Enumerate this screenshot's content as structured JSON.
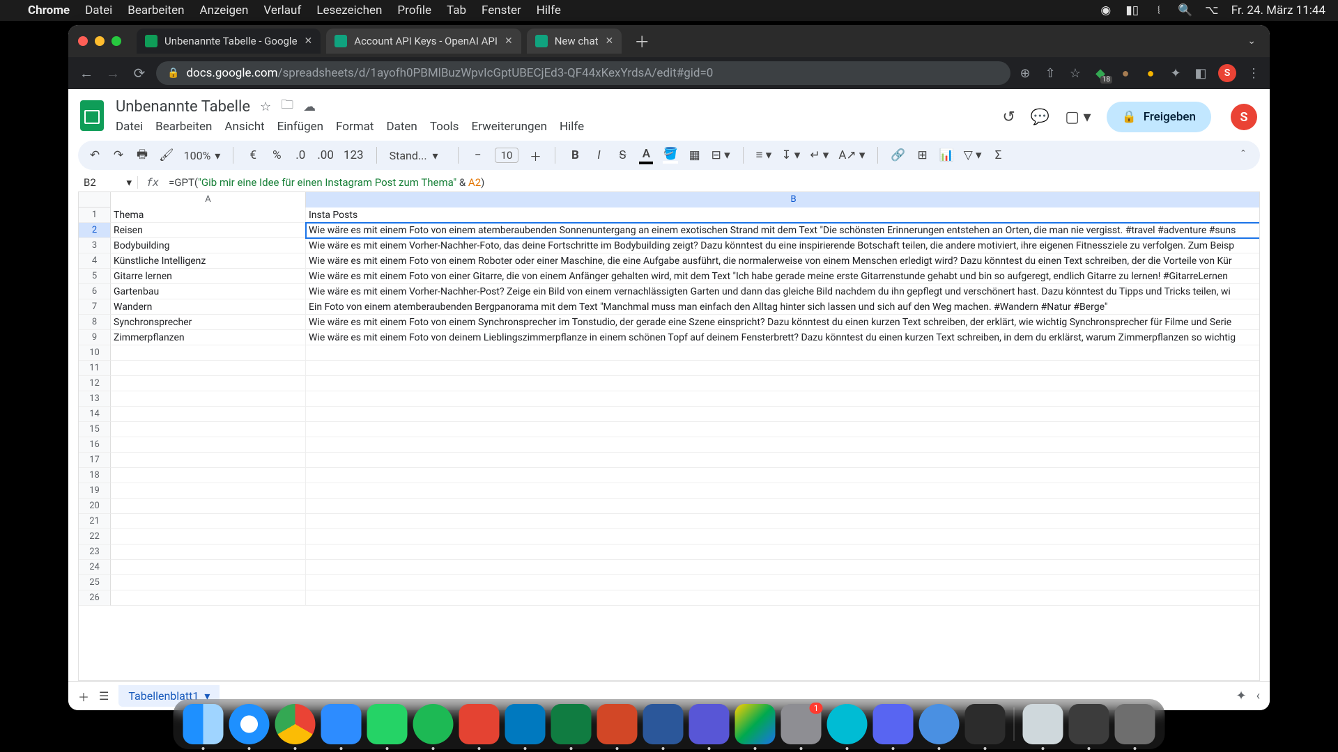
{
  "mac_menu": {
    "app": "Chrome",
    "items": [
      "Datei",
      "Bearbeiten",
      "Anzeigen",
      "Verlauf",
      "Lesezeichen",
      "Profile",
      "Tab",
      "Fenster",
      "Hilfe"
    ],
    "clock": "Fr. 24. März 11:44"
  },
  "browser": {
    "tabs": [
      {
        "title": "Unbenannte Tabelle - Google",
        "active": true
      },
      {
        "title": "Account API Keys - OpenAI API",
        "active": false
      },
      {
        "title": "New chat",
        "active": false
      }
    ],
    "url_domain": "docs.google.com",
    "url_path": "/spreadsheets/d/1ayofh0PBMlBuzWpvIcGptUBECjEd3-QF44xKexYrdsA/edit#gid=0",
    "ext_count": "18",
    "profile_letter": "S"
  },
  "sheets": {
    "doc_title": "Unbenannte Tabelle",
    "menus": [
      "Datei",
      "Bearbeiten",
      "Ansicht",
      "Einfügen",
      "Format",
      "Daten",
      "Tools",
      "Erweiterungen",
      "Hilfe"
    ],
    "share_label": "Freigeben",
    "avatar_letter": "S",
    "zoom": "100%",
    "font_family": "Stand...",
    "font_size": "10",
    "name_box": "B2",
    "formula": {
      "prefix": "=GPT(",
      "string": "\"Gib mir eine Idee für einen Instagram Post zum Thema\"",
      "op": " & ",
      "ref": "A2",
      "suffix": ")"
    },
    "columns": [
      "A",
      "B"
    ],
    "rows": [
      {
        "n": "1",
        "a": "Thema",
        "b": "Insta Posts"
      },
      {
        "n": "2",
        "a": "Reisen",
        "b": "Wie wäre es mit einem Foto von einem atemberaubenden Sonnenuntergang an einem exotischen Strand mit dem Text \"Die schönsten Erinnerungen entstehen an Orten, die man nie vergisst. #travel #adventure #suns"
      },
      {
        "n": "3",
        "a": "Bodybuilding",
        "b": "Wie wäre es mit einem Vorher-Nachher-Foto, das deine Fortschritte im Bodybuilding zeigt? Dazu könntest du eine inspirierende Botschaft teilen, die andere motiviert, ihre eigenen Fitnessziele zu verfolgen. Zum Beisp"
      },
      {
        "n": "4",
        "a": "Künstliche Intelligenz",
        "b": "Wie wäre es mit einem Foto von einem Roboter oder einer Maschine, die eine Aufgabe ausführt, die normalerweise von einem Menschen erledigt wird? Dazu könntest du einen Text schreiben, der die Vorteile von Kür"
      },
      {
        "n": "5",
        "a": "Gitarre lernen",
        "b": "Wie wäre es mit einem Foto von einer Gitarre, die von einem Anfänger gehalten wird, mit dem Text \"Ich habe gerade meine erste Gitarrenstunde gehabt und bin so aufgeregt, endlich Gitarre zu lernen! #GitarreLernen"
      },
      {
        "n": "6",
        "a": "Gartenbau",
        "b": "Wie wäre es mit einem Vorher-Nachher-Post? Zeige ein Bild von einem vernachlässigten Garten und dann das gleiche Bild nachdem du ihn gepflegt und verschönert hast. Dazu könntest du Tipps und Tricks teilen, wi"
      },
      {
        "n": "7",
        "a": "Wandern",
        "b": "Ein Foto von einem atemberaubenden Bergpanorama mit dem Text \"Manchmal muss man einfach den Alltag hinter sich lassen und sich auf den Weg machen. #Wandern #Natur #Berge\""
      },
      {
        "n": "8",
        "a": "Synchronsprecher",
        "b": "Wie wäre es mit einem Foto von einem Synchronsprecher im Tonstudio, der gerade eine Szene einspricht? Dazu könntest du einen kurzen Text schreiben, der erklärt, wie wichtig Synchronsprecher für Filme und Serie"
      },
      {
        "n": "9",
        "a": "Zimmerpflanzen",
        "b": "Wie wäre es mit einem Foto von deinem Lieblingszimmerpflanze in einem schönen Topf auf deinem Fensterbrett? Dazu könntest du einen kurzen Text schreiben, in dem du erklärst, warum Zimmerpflanzen so wichtig"
      },
      {
        "n": "10",
        "a": "",
        "b": ""
      },
      {
        "n": "11",
        "a": "",
        "b": ""
      },
      {
        "n": "12",
        "a": "",
        "b": ""
      },
      {
        "n": "13",
        "a": "",
        "b": ""
      },
      {
        "n": "14",
        "a": "",
        "b": ""
      },
      {
        "n": "15",
        "a": "",
        "b": ""
      },
      {
        "n": "16",
        "a": "",
        "b": ""
      },
      {
        "n": "17",
        "a": "",
        "b": ""
      },
      {
        "n": "18",
        "a": "",
        "b": ""
      },
      {
        "n": "19",
        "a": "",
        "b": ""
      },
      {
        "n": "20",
        "a": "",
        "b": ""
      },
      {
        "n": "21",
        "a": "",
        "b": ""
      },
      {
        "n": "22",
        "a": "",
        "b": ""
      },
      {
        "n": "23",
        "a": "",
        "b": ""
      },
      {
        "n": "24",
        "a": "",
        "b": ""
      },
      {
        "n": "25",
        "a": "",
        "b": ""
      },
      {
        "n": "26",
        "a": "",
        "b": ""
      }
    ],
    "selected_row": "2",
    "sheet_tab": "Tabellenblatt1"
  },
  "dock": {
    "items": [
      {
        "name": "finder",
        "cls": "di-finder"
      },
      {
        "name": "safari",
        "cls": "di-safari round"
      },
      {
        "name": "chrome",
        "cls": "di-chrome round"
      },
      {
        "name": "zoom",
        "cls": "di-zoom"
      },
      {
        "name": "whatsapp",
        "cls": "di-wa"
      },
      {
        "name": "spotify",
        "cls": "di-spotify"
      },
      {
        "name": "todoist",
        "cls": "di-todoist"
      },
      {
        "name": "trello",
        "cls": "di-trello"
      },
      {
        "name": "excel",
        "cls": "di-excel"
      },
      {
        "name": "powerpoint",
        "cls": "di-ppt"
      },
      {
        "name": "word",
        "cls": "di-word"
      },
      {
        "name": "imovie",
        "cls": "di-imovie"
      },
      {
        "name": "drive",
        "cls": "di-drive"
      },
      {
        "name": "settings",
        "cls": "di-settings",
        "badge": "1"
      },
      {
        "name": "app-blue",
        "cls": "di-blue round"
      },
      {
        "name": "discord",
        "cls": "di-discord"
      },
      {
        "name": "quicktime",
        "cls": "di-qt round"
      },
      {
        "name": "audio",
        "cls": "di-audio"
      }
    ],
    "right_items": [
      {
        "name": "preview",
        "cls": "di-preview"
      },
      {
        "name": "mission-control",
        "cls": "di-mission"
      },
      {
        "name": "trash",
        "cls": "di-trash"
      }
    ]
  }
}
